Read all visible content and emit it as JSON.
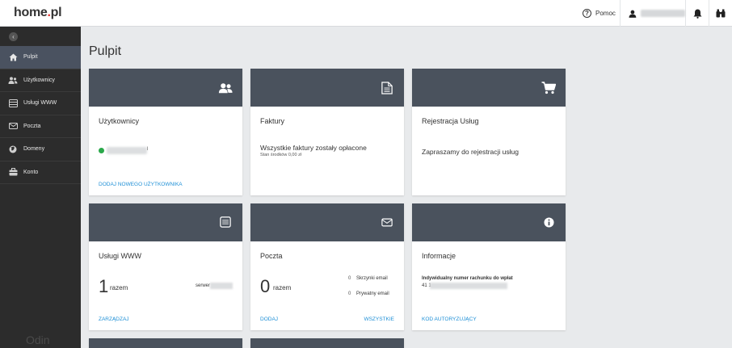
{
  "header": {
    "logo_main": "home",
    "logo_dot": ".",
    "logo_tld": "pl",
    "help_label": "Pomoc"
  },
  "sidebar": {
    "items": [
      {
        "label": "Pulpit",
        "icon": "home-icon"
      },
      {
        "label": "Użytkownicy",
        "icon": "users-icon"
      },
      {
        "label": "Usługi WWW",
        "icon": "server-icon"
      },
      {
        "label": "Poczta",
        "icon": "mail-icon"
      },
      {
        "label": "Domeny",
        "icon": "globe-icon"
      },
      {
        "label": "Konto",
        "icon": "briefcase-icon"
      }
    ],
    "footer": "Odin"
  },
  "page": {
    "title": "Pulpit"
  },
  "cards": {
    "users": {
      "title": "Użytkownicy",
      "suffix": "l",
      "link": "DODAJ NOWEGO UŻYTKOWNIKA"
    },
    "invoices": {
      "title": "Faktury",
      "message": "Wszystkie faktury zostały opłacone",
      "balance": "Stan środków 0,00 zł"
    },
    "registration": {
      "title": "Rejestracja Usług",
      "message": "Zapraszamy do rejestracji usług"
    },
    "www": {
      "title": "Usługi WWW",
      "count": "1",
      "count_label": "razem",
      "server_label": "serwer",
      "link": "ZARZĄDZAJ"
    },
    "mail": {
      "title": "Poczta",
      "count": "0",
      "count_label": "razem",
      "rows": [
        {
          "count": "0",
          "label": "Skrzynki email"
        },
        {
          "count": "0",
          "label": "Prywatny email"
        }
      ],
      "link_left": "DODAJ",
      "link_right": "WSZYSTKIE"
    },
    "info": {
      "title": "Informacje",
      "account_label": "Indywidualny numer rachunku do wpłat",
      "account_prefix": "41 1",
      "link": "KOD AUTORYZUJĄCY"
    }
  },
  "colors": {
    "accent": "#1e8fd6",
    "card_header": "#4a525d",
    "sidebar": "#2c2c2c",
    "active": "#4a5260",
    "ok": "#2aa84a"
  }
}
